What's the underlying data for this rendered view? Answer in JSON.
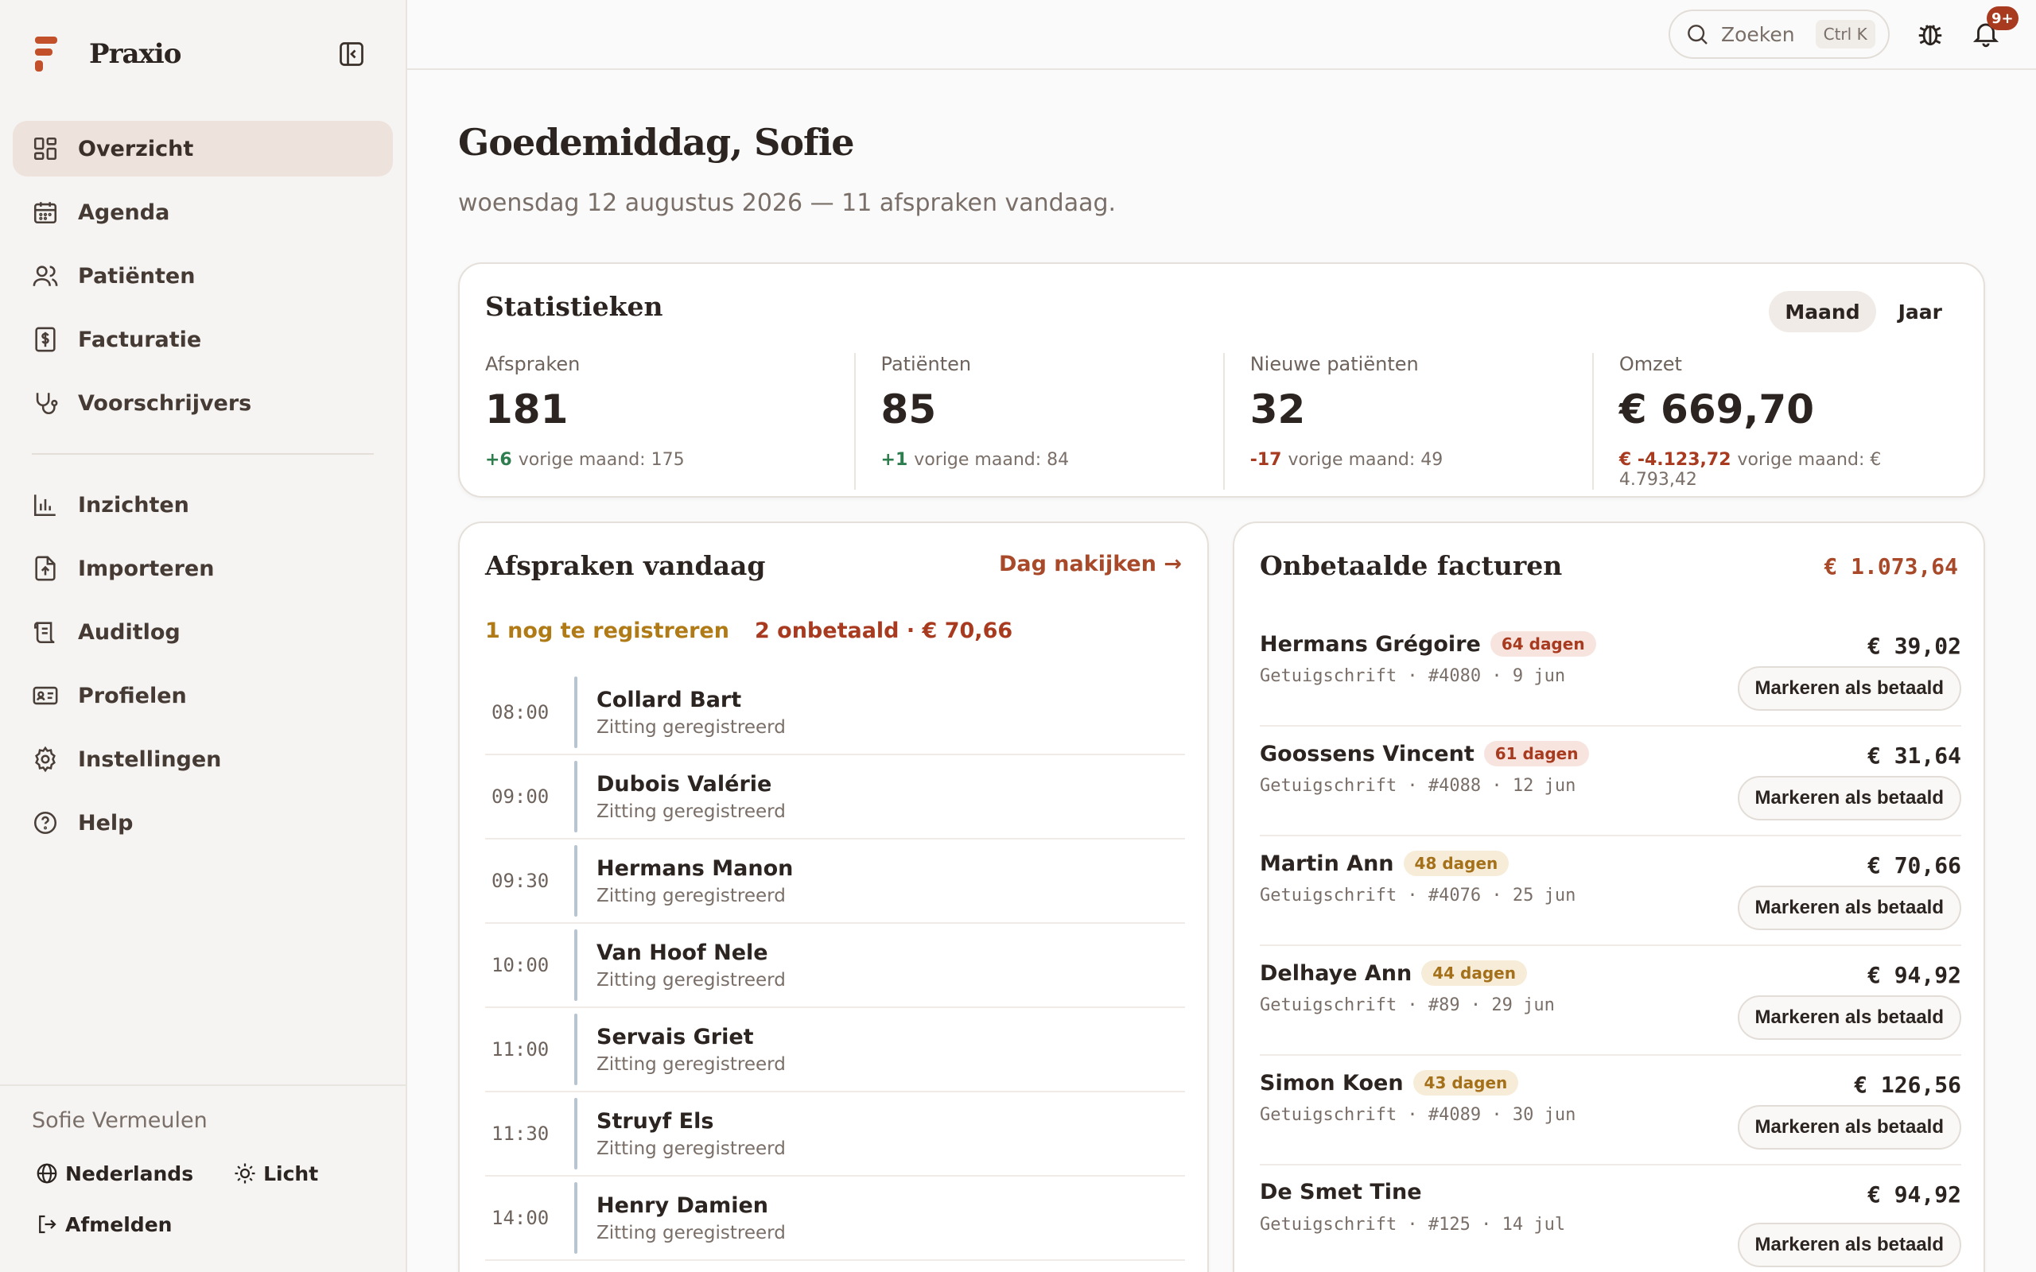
{
  "app": {
    "name": "Praxio"
  },
  "sidebar": {
    "items": [
      {
        "label": "Overzicht",
        "icon": "grid-icon"
      },
      {
        "label": "Agenda",
        "icon": "calendar-icon"
      },
      {
        "label": "Patiënten",
        "icon": "users-icon"
      },
      {
        "label": "Facturatie",
        "icon": "invoice-icon"
      },
      {
        "label": "Voorschrijvers",
        "icon": "stethoscope-icon"
      }
    ],
    "items2": [
      {
        "label": "Inzichten",
        "icon": "bar-chart-icon"
      },
      {
        "label": "Importeren",
        "icon": "file-import-icon"
      },
      {
        "label": "Auditlog",
        "icon": "log-icon"
      },
      {
        "label": "Profielen",
        "icon": "id-card-icon"
      },
      {
        "label": "Instellingen",
        "icon": "gear-icon"
      },
      {
        "label": "Help",
        "icon": "help-icon"
      }
    ],
    "user": "Sofie Vermeulen",
    "language": "Nederlands",
    "theme": "Licht",
    "logout": "Afmelden"
  },
  "topbar": {
    "search_placeholder": "Zoeken",
    "shortcut": "Ctrl K",
    "notifications_badge": "9+"
  },
  "header": {
    "greeting": "Goedemiddag, Sofie",
    "subline": "woensdag 12 augustus 2026 — 11 afspraken vandaag."
  },
  "stats": {
    "title": "Statistieken",
    "toggle": [
      "Maand",
      "Jaar"
    ],
    "items": [
      {
        "label": "Afspraken",
        "value": "181",
        "delta": "+6",
        "prev": "vorige maand: 175",
        "trend": "pos"
      },
      {
        "label": "Patiënten",
        "value": "85",
        "delta": "+1",
        "prev": "vorige maand: 84",
        "trend": "pos"
      },
      {
        "label": "Nieuwe patiënten",
        "value": "32",
        "delta": "-17",
        "prev": "vorige maand: 49",
        "trend": "neg"
      },
      {
        "label": "Omzet",
        "value": "€ 669,70",
        "delta": "€ -4.123,72",
        "prev": "vorige maand: € 4.793,42",
        "trend": "neg"
      }
    ]
  },
  "appointments": {
    "title": "Afspraken vandaag",
    "link": "Dag nakijken →",
    "alert_register": "1 nog te registreren",
    "alert_unpaid": "2 onbetaald · € 70,66",
    "rows": [
      {
        "time": "08:00",
        "name": "Collard Bart",
        "status": "Zitting geregistreerd"
      },
      {
        "time": "09:00",
        "name": "Dubois Valérie",
        "status": "Zitting geregistreerd"
      },
      {
        "time": "09:30",
        "name": "Hermans Manon",
        "status": "Zitting geregistreerd"
      },
      {
        "time": "10:00",
        "name": "Van Hoof Nele",
        "status": "Zitting geregistreerd"
      },
      {
        "time": "11:00",
        "name": "Servais Griet",
        "status": "Zitting geregistreerd"
      },
      {
        "time": "11:30",
        "name": "Struyf Els",
        "status": "Zitting geregistreerd"
      },
      {
        "time": "14:00",
        "name": "Henry Damien",
        "status": "Zitting geregistreerd"
      }
    ]
  },
  "invoices": {
    "title": "Onbetaalde facturen",
    "total": "€ 1.073,64",
    "button_label": "Markeren als betaald",
    "rows": [
      {
        "name": "Hermans Grégoire",
        "days": "64 dagen",
        "level": "red",
        "meta": "Getuigschrift · #4080 · 9 jun",
        "amount": "€ 39,02"
      },
      {
        "name": "Goossens Vincent",
        "days": "61 dagen",
        "level": "red",
        "meta": "Getuigschrift · #4088 · 12 jun",
        "amount": "€ 31,64"
      },
      {
        "name": "Martin Ann",
        "days": "48 dagen",
        "level": "amber",
        "meta": "Getuigschrift · #4076 · 25 jun",
        "amount": "€ 70,66"
      },
      {
        "name": "Delhaye Ann",
        "days": "44 dagen",
        "level": "amber",
        "meta": "Getuigschrift · #89 · 29 jun",
        "amount": "€ 94,92"
      },
      {
        "name": "Simon Koen",
        "days": "43 dagen",
        "level": "amber",
        "meta": "Getuigschrift · #4089 · 30 jun",
        "amount": "€ 126,56"
      },
      {
        "name": "De Smet Tine",
        "days": "",
        "level": "",
        "meta": "Getuigschrift · #125 · 14 jul",
        "amount": "€ 94,92"
      }
    ]
  },
  "colors": {
    "accent": "#a84a2a",
    "positive": "#2e7d4f",
    "negative": "#a83a1f",
    "warning": "#b07a16"
  }
}
